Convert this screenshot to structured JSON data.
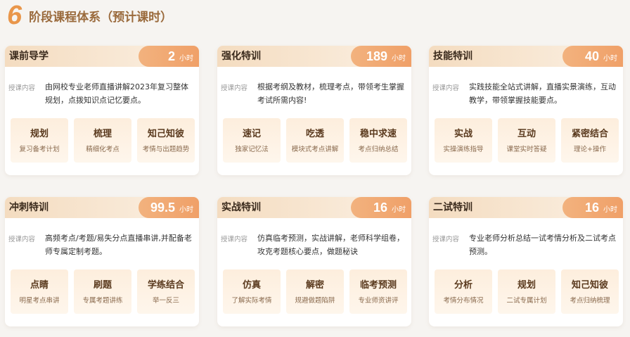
{
  "header": {
    "number": "6",
    "title": "阶段课程体系（预计课时）"
  },
  "desc_label": "授课内容",
  "hours_unit": "小时",
  "cards": [
    {
      "title": "课前导学",
      "hours": "2",
      "desc": "由网校专业老师直播讲解2023年复习整体规划，点拨知识点记忆要点。",
      "features": [
        {
          "title": "规划",
          "sub": "复习备考计划"
        },
        {
          "title": "梳理",
          "sub": "精细化考点"
        },
        {
          "title": "知己知彼",
          "sub": "考情与出题趋势"
        }
      ]
    },
    {
      "title": "强化特训",
      "hours": "189",
      "desc": "根据考纲及教材，梳理考点，带领考生掌握考试所需内容!",
      "features": [
        {
          "title": "速记",
          "sub": "独家记忆法"
        },
        {
          "title": "吃透",
          "sub": "模块式考点讲解"
        },
        {
          "title": "稳中求速",
          "sub": "考点归纳总结"
        }
      ]
    },
    {
      "title": "技能特训",
      "hours": "40",
      "desc": "实践技能全站式讲解，直播实景演练，互动教学，带领掌握技能要点。",
      "features": [
        {
          "title": "实战",
          "sub": "实操演练指导"
        },
        {
          "title": "互动",
          "sub": "课堂实时答疑"
        },
        {
          "title": "紧密结合",
          "sub": "理论+操作"
        }
      ]
    },
    {
      "title": "冲刺特训",
      "hours": "99.5",
      "desc": "高频考点/考题/易失分点直播串讲,并配备老师专属定制考题。",
      "features": [
        {
          "title": "点睛",
          "sub": "明星考点串讲"
        },
        {
          "title": "刷题",
          "sub": "专属考题讲练"
        },
        {
          "title": "学练结合",
          "sub": "举一反三"
        }
      ]
    },
    {
      "title": "实战特训",
      "hours": "16",
      "desc": "仿真临考预测，实战讲解，老师科学组卷，攻克考题核心要点，做题秘诀",
      "features": [
        {
          "title": "仿真",
          "sub": "了解实际考情"
        },
        {
          "title": "解密",
          "sub": "规避做题陷阱"
        },
        {
          "title": "临考预测",
          "sub": "专业师资讲评"
        }
      ]
    },
    {
      "title": "二试特训",
      "hours": "16",
      "desc": "专业老师分析总结一试考情分析及二试考点预测。",
      "features": [
        {
          "title": "分析",
          "sub": "考情分布情况"
        },
        {
          "title": "规划",
          "sub": "二试专属计划"
        },
        {
          "title": "知己知彼",
          "sub": "考点归纳梳理"
        }
      ]
    }
  ]
}
